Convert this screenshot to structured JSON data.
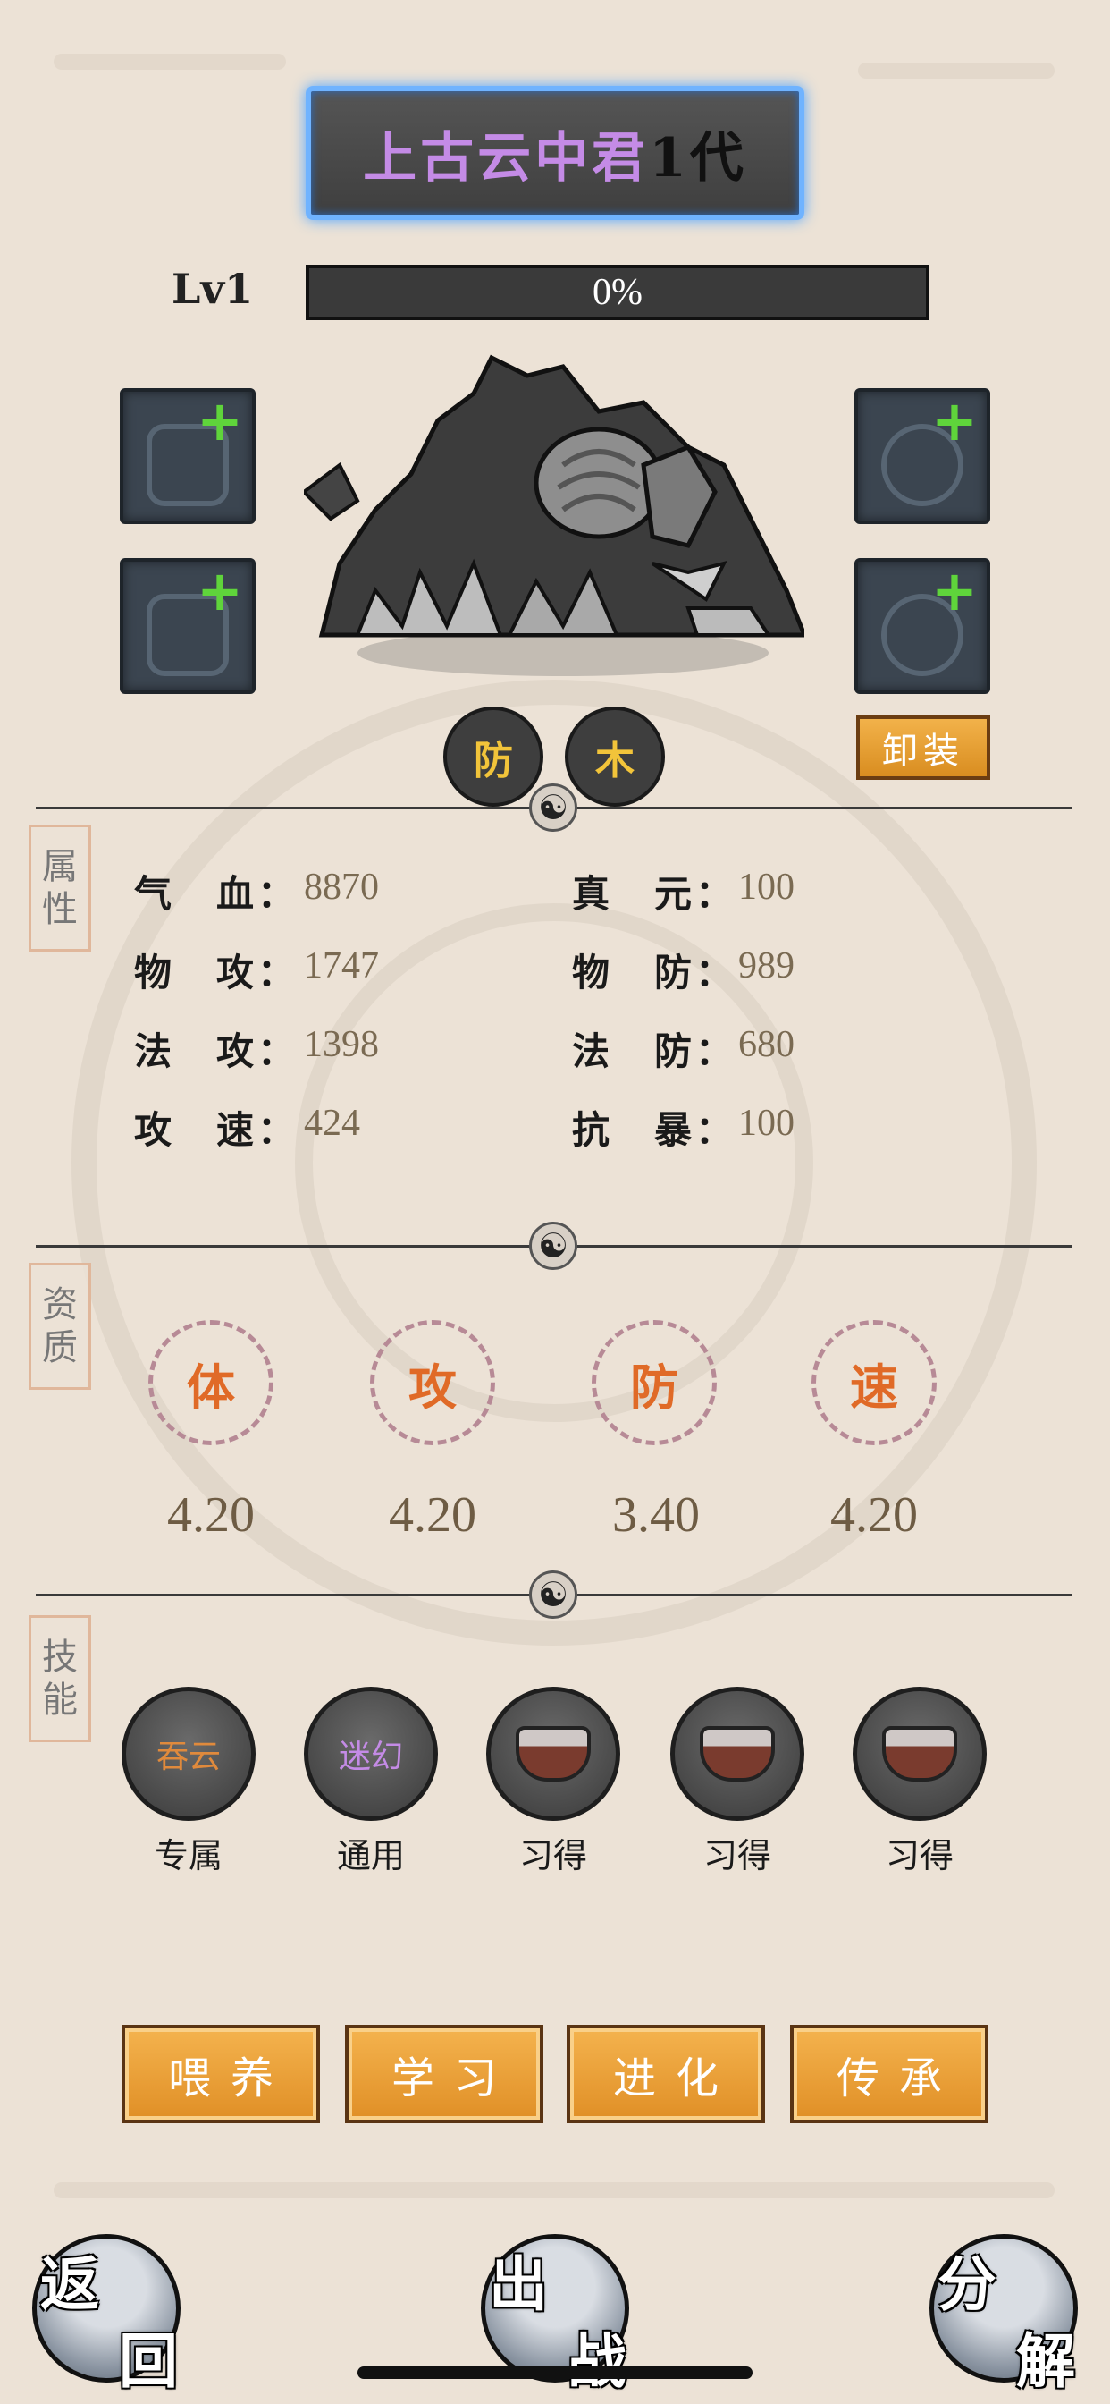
{
  "header": {
    "pet_name": "上古云中君",
    "generation": "1代",
    "level": "Lv1",
    "exp_text": "0%",
    "exp_progress": 0
  },
  "pet": {
    "attribute_tags": [
      "防",
      "木"
    ],
    "unequip_label": "卸装",
    "equip_slots": [
      "glove-icon",
      "ring-icon",
      "armor-icon",
      "necklace-icon"
    ]
  },
  "sections": {
    "attributes_tag": [
      "属",
      "性"
    ],
    "aptitude_tag": [
      "资",
      "质"
    ],
    "skills_tag": [
      "技",
      "能"
    ]
  },
  "stats": [
    {
      "label": "气　血：",
      "value": "8870"
    },
    {
      "label": "真　元：",
      "value": "100"
    },
    {
      "label": "物　攻：",
      "value": "1747"
    },
    {
      "label": "物　防：",
      "value": "989"
    },
    {
      "label": "法　攻：",
      "value": "1398"
    },
    {
      "label": "法　防：",
      "value": "680"
    },
    {
      "label": "攻　速：",
      "value": "424"
    },
    {
      "label": "抗　暴：",
      "value": "100"
    }
  ],
  "aptitude": [
    {
      "label": "体",
      "value": "4.20"
    },
    {
      "label": "攻",
      "value": "4.20"
    },
    {
      "label": "防",
      "value": "3.40"
    },
    {
      "label": "速",
      "value": "4.20"
    }
  ],
  "skills": [
    {
      "name": "吞云",
      "caption": "专属",
      "color": "#e08a3c"
    },
    {
      "name": "迷幻",
      "caption": "通用",
      "color": "#c48be6"
    },
    {
      "name": "",
      "caption": "习得"
    },
    {
      "name": "",
      "caption": "习得"
    },
    {
      "name": "",
      "caption": "习得"
    }
  ],
  "actions": [
    "喂养",
    "学习",
    "进化",
    "传承"
  ],
  "bottom": {
    "back": [
      "返",
      "回"
    ],
    "battle": [
      "出",
      "战"
    ],
    "decompose": [
      "分",
      "解"
    ]
  },
  "colors": {
    "accent_orange": "#e8a038",
    "title_purple": "#c48be6",
    "plus_green": "#5fd43b",
    "aptitude_orange": "#e06a27"
  }
}
